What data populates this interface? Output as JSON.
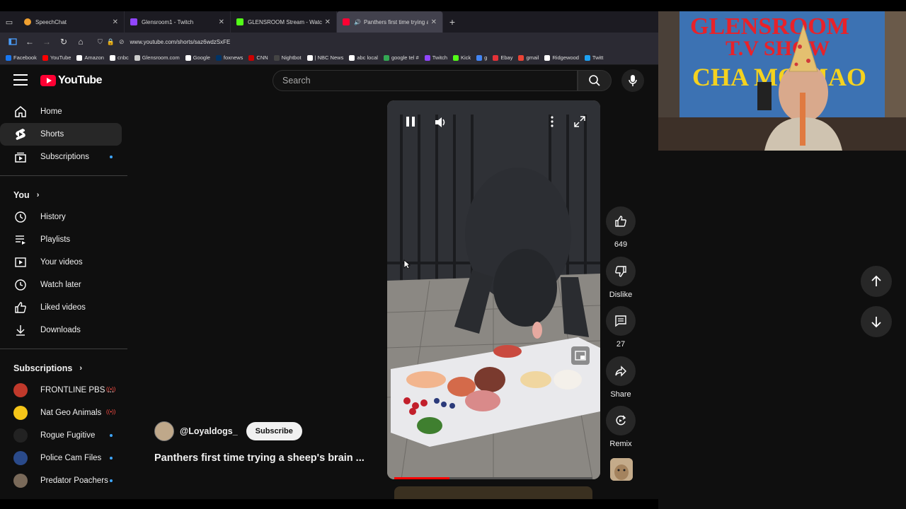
{
  "browser": {
    "tabs": [
      {
        "title": "SpeechChat",
        "color": "#f0a030"
      },
      {
        "title": "Glensroom1 - Twitch",
        "color": "#9146ff"
      },
      {
        "title": "GLENSROOM Stream - Watch Li",
        "color": "#53fc18"
      },
      {
        "title": "Panthers first time trying a",
        "color": "#ff0033"
      }
    ],
    "url": "www.youtube.com/shorts/saz6wdzSxFE",
    "bookmarks": [
      {
        "label": "Facebook",
        "color": "#1877f2"
      },
      {
        "label": "YouTube",
        "color": "#ff0000"
      },
      {
        "label": "Amazon",
        "color": "#ffffff"
      },
      {
        "label": "cnbc",
        "color": "#ffffff"
      },
      {
        "label": "Glensroom.com",
        "color": "#cccccc"
      },
      {
        "label": "Google",
        "color": "#ffffff"
      },
      {
        "label": "foxnews",
        "color": "#003366"
      },
      {
        "label": "CNN",
        "color": "#cc0000"
      },
      {
        "label": "Nightbot",
        "color": "#444444"
      },
      {
        "label": "| NBC News",
        "color": "#ffffff"
      },
      {
        "label": "abc local",
        "color": "#ffffff"
      },
      {
        "label": "google tel #",
        "color": "#34a853"
      },
      {
        "label": "Twitch",
        "color": "#9146ff"
      },
      {
        "label": "Kick",
        "color": "#53fc18"
      },
      {
        "label": "g",
        "color": "#4285f4"
      },
      {
        "label": "Ebay",
        "color": "#e53238"
      },
      {
        "label": "gmail",
        "color": "#ea4335"
      },
      {
        "label": "Ridgewood",
        "color": "#ffffff"
      },
      {
        "label": "Twitt",
        "color": "#1da1f2"
      }
    ]
  },
  "youtube": {
    "logo_text": "YouTube",
    "search_placeholder": "Search",
    "sidebar": {
      "main": [
        {
          "label": "Home",
          "icon": "home-icon"
        },
        {
          "label": "Shorts",
          "icon": "shorts-icon",
          "active": true
        },
        {
          "label": "Subscriptions",
          "icon": "subscriptions-icon",
          "dot": true
        }
      ],
      "you_label": "You",
      "you_items": [
        {
          "label": "History",
          "icon": "history-icon"
        },
        {
          "label": "Playlists",
          "icon": "playlists-icon"
        },
        {
          "label": "Your videos",
          "icon": "your-videos-icon"
        },
        {
          "label": "Watch later",
          "icon": "watch-later-icon"
        },
        {
          "label": "Liked videos",
          "icon": "liked-videos-icon"
        },
        {
          "label": "Downloads",
          "icon": "downloads-icon"
        }
      ],
      "subscriptions_label": "Subscriptions",
      "subscriptions": [
        {
          "label": "FRONTLINE PBS ...",
          "color": "#c0392b",
          "live": true
        },
        {
          "label": "Nat Geo Animals",
          "color": "#f5c518",
          "live": true
        },
        {
          "label": "Rogue Fugitive",
          "color": "#222222",
          "dot": true
        },
        {
          "label": "Police Cam Files",
          "color": "#2a4a8a",
          "dot": true
        },
        {
          "label": "Predator Poachers",
          "color": "#7a6a5a",
          "dot": true
        }
      ]
    },
    "short": {
      "channel": "@Loyaldogs_",
      "subscribe_label": "Subscribe",
      "title": "Panthers first time trying a sheep's brain ...",
      "likes": "649",
      "dislike_label": "Dislike",
      "comments": "27",
      "share_label": "Share",
      "remix_label": "Remix",
      "progress": 0.28
    }
  }
}
